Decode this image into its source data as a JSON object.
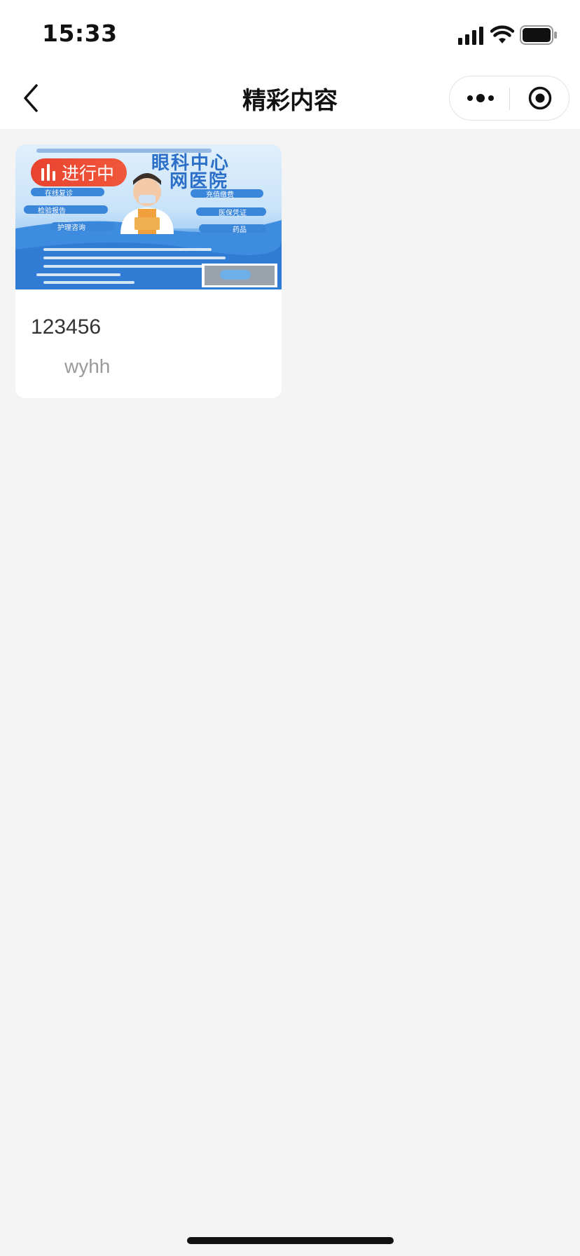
{
  "status_bar": {
    "time": "15:33",
    "icons": [
      "signal-icon",
      "wifi-icon",
      "battery-icon"
    ]
  },
  "nav": {
    "title": "精彩内容",
    "icons": [
      "back-icon",
      "more-icon",
      "close-icon"
    ]
  },
  "cards": [
    {
      "badge": "进行中",
      "title": "123456",
      "author": "wyhh",
      "poster": {
        "headline_line1": "眼科中心",
        "headline_line2": "网医院",
        "services": [
          "在线复诊",
          "充值缴费",
          "检验报告",
          "医保凭证",
          "护理咨询",
          "药品"
        ]
      }
    }
  ],
  "colors": {
    "page_background": "#f4f4f4",
    "badge": "#e8432f",
    "poster_blue": "#2f7fd8"
  }
}
